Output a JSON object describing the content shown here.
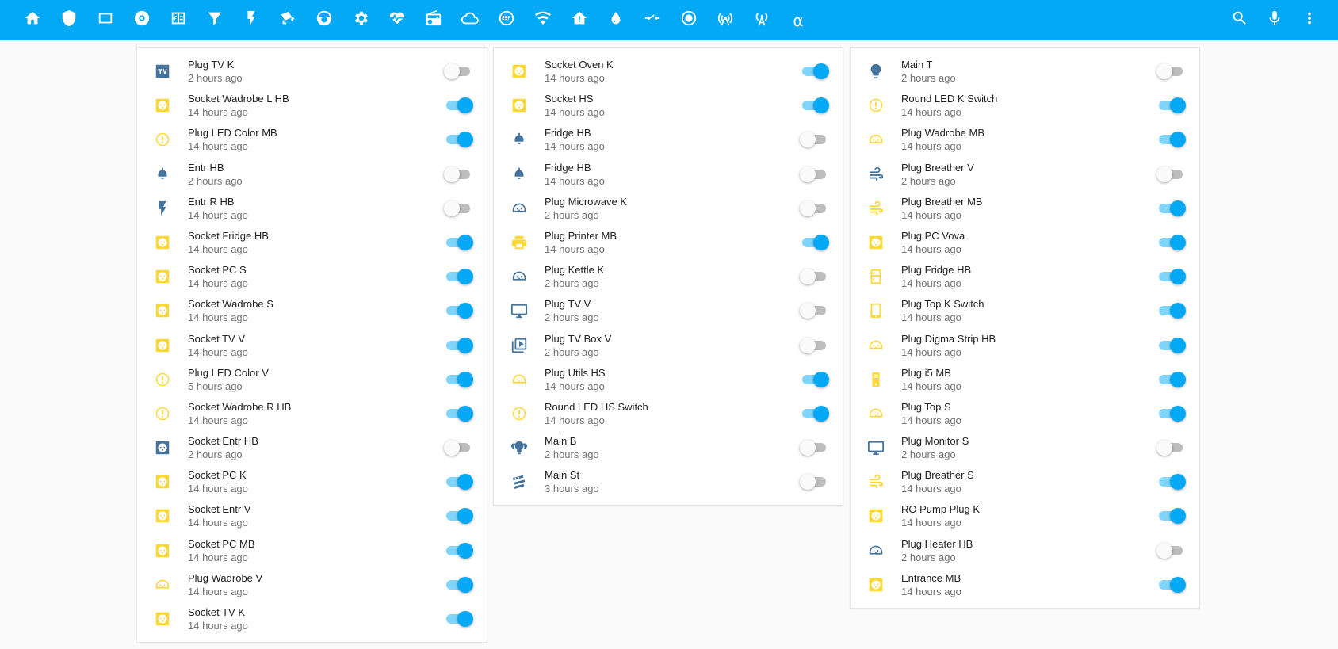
{
  "colors": {
    "header": "#03a9f4",
    "icon_on": "#fdd835",
    "icon_off": "#44739e",
    "toggle_on": "#03a9f4"
  },
  "header": {
    "tabs": [
      {
        "icon": "home-icon"
      },
      {
        "icon": "shield-icon"
      },
      {
        "icon": "square-icon"
      },
      {
        "icon": "disc-icon"
      },
      {
        "icon": "calculator-icon"
      },
      {
        "icon": "filter-icon"
      },
      {
        "icon": "flash-icon"
      },
      {
        "icon": "cctv-icon"
      },
      {
        "icon": "robot-vacuum-icon"
      },
      {
        "icon": "gear-icon"
      },
      {
        "icon": "heart-pulse-icon"
      },
      {
        "icon": "radio-icon"
      },
      {
        "icon": "cloud-icon"
      },
      {
        "icon": "esp-icon"
      },
      {
        "icon": "wifi-icon"
      },
      {
        "icon": "home-alert-icon"
      },
      {
        "icon": "water-icon"
      },
      {
        "icon": "switch-icon"
      },
      {
        "icon": "record-icon"
      },
      {
        "icon": "access-point-icon"
      },
      {
        "icon": "antenna-icon"
      },
      {
        "icon": "alpha-icon",
        "text": "α"
      }
    ],
    "actions": [
      {
        "icon": "search-icon"
      },
      {
        "icon": "microphone-icon"
      },
      {
        "icon": "more-vertical-icon"
      }
    ]
  },
  "cards": [
    {
      "rows": [
        {
          "name": "Plug TV K",
          "time": "2 hours ago",
          "on": false,
          "icon": "tv-box-icon"
        },
        {
          "name": "Socket Wadrobe L HB",
          "time": "14 hours ago",
          "on": true,
          "icon": "power-socket-icon"
        },
        {
          "name": "Plug LED Color MB",
          "time": "14 hours ago",
          "on": true,
          "icon": "led-icon"
        },
        {
          "name": "Entr HB",
          "time": "2 hours ago",
          "on": false,
          "icon": "ceiling-light-icon"
        },
        {
          "name": "Entr R HB",
          "time": "14 hours ago",
          "on": false,
          "icon": "flash-icon"
        },
        {
          "name": "Socket Fridge HB",
          "time": "14 hours ago",
          "on": true,
          "icon": "power-socket-icon"
        },
        {
          "name": "Socket PC S",
          "time": "14 hours ago",
          "on": true,
          "icon": "power-socket-icon"
        },
        {
          "name": "Socket Wadrobe S",
          "time": "14 hours ago",
          "on": true,
          "icon": "power-socket-icon"
        },
        {
          "name": "Socket TV V",
          "time": "14 hours ago",
          "on": true,
          "icon": "power-socket-icon"
        },
        {
          "name": "Plug LED Color V",
          "time": "5 hours ago",
          "on": true,
          "icon": "led-icon"
        },
        {
          "name": "Socket Wadrobe R HB",
          "time": "14 hours ago",
          "on": true,
          "icon": "led-icon"
        },
        {
          "name": "Socket Entr HB",
          "time": "2 hours ago",
          "on": false,
          "icon": "power-socket-icon"
        },
        {
          "name": "Socket PC K",
          "time": "14 hours ago",
          "on": true,
          "icon": "power-socket-icon"
        },
        {
          "name": "Socket Entr V",
          "time": "14 hours ago",
          "on": true,
          "icon": "power-socket-icon"
        },
        {
          "name": "Socket PC MB",
          "time": "14 hours ago",
          "on": true,
          "icon": "power-socket-icon"
        },
        {
          "name": "Plug Wadrobe V",
          "time": "14 hours ago",
          "on": true,
          "icon": "plug-icon"
        },
        {
          "name": "Socket TV K",
          "time": "14 hours ago",
          "on": true,
          "icon": "power-socket-icon"
        }
      ]
    },
    {
      "rows": [
        {
          "name": "Socket Oven K",
          "time": "14 hours ago",
          "on": true,
          "icon": "power-socket-icon"
        },
        {
          "name": "Socket HS",
          "time": "14 hours ago",
          "on": true,
          "icon": "power-socket-icon"
        },
        {
          "name": "Fridge HB",
          "time": "14 hours ago",
          "on": false,
          "icon": "ceiling-light-icon"
        },
        {
          "name": "Fridge HB",
          "time": "14 hours ago",
          "on": false,
          "icon": "ceiling-light-icon"
        },
        {
          "name": "Plug Microwave K",
          "time": "2 hours ago",
          "on": false,
          "icon": "plug-icon"
        },
        {
          "name": "Plug Printer MB",
          "time": "14 hours ago",
          "on": true,
          "icon": "printer-icon"
        },
        {
          "name": "Plug Kettle K",
          "time": "2 hours ago",
          "on": false,
          "icon": "plug-icon"
        },
        {
          "name": "Plug TV V",
          "time": "2 hours ago",
          "on": false,
          "icon": "monitor-icon"
        },
        {
          "name": "Plug TV Box V",
          "time": "2 hours ago",
          "on": false,
          "icon": "play-box-icon"
        },
        {
          "name": "Plug Utils HS",
          "time": "14 hours ago",
          "on": true,
          "icon": "plug-icon"
        },
        {
          "name": "Round LED HS Switch",
          "time": "14 hours ago",
          "on": true,
          "icon": "led-icon"
        },
        {
          "name": "Main B",
          "time": "2 hours ago",
          "on": false,
          "icon": "lightbulb-group-icon"
        },
        {
          "name": "Main St",
          "time": "3 hours ago",
          "on": false,
          "icon": "led-strip-icon"
        }
      ]
    },
    {
      "rows": [
        {
          "name": "Main T",
          "time": "2 hours ago",
          "on": false,
          "icon": "lightbulb-icon"
        },
        {
          "name": "Round LED K Switch",
          "time": "14 hours ago",
          "on": true,
          "icon": "led-icon"
        },
        {
          "name": "Plug Wadrobe MB",
          "time": "14 hours ago",
          "on": true,
          "icon": "plug-icon"
        },
        {
          "name": "Plug Breather V",
          "time": "2 hours ago",
          "on": false,
          "icon": "wind-icon"
        },
        {
          "name": "Plug Breather MB",
          "time": "14 hours ago",
          "on": true,
          "icon": "wind-icon"
        },
        {
          "name": "Plug PC Vova",
          "time": "14 hours ago",
          "on": true,
          "icon": "power-socket-icon"
        },
        {
          "name": "Plug Fridge HB",
          "time": "14 hours ago",
          "on": true,
          "icon": "fridge-icon"
        },
        {
          "name": "Plug Top K Switch",
          "time": "14 hours ago",
          "on": true,
          "icon": "tablet-icon"
        },
        {
          "name": "Plug Digma Strip HB",
          "time": "14 hours ago",
          "on": true,
          "icon": "plug-icon"
        },
        {
          "name": "Plug i5 MB",
          "time": "14 hours ago",
          "on": true,
          "icon": "desktop-tower-icon"
        },
        {
          "name": "Plug Top S",
          "time": "14 hours ago",
          "on": true,
          "icon": "plug-icon"
        },
        {
          "name": "Plug Monitor S",
          "time": "2 hours ago",
          "on": false,
          "icon": "monitor-icon"
        },
        {
          "name": "Plug Breather S",
          "time": "14 hours ago",
          "on": true,
          "icon": "wind-icon"
        },
        {
          "name": "RO Pump Plug K",
          "time": "14 hours ago",
          "on": true,
          "icon": "power-socket-icon"
        },
        {
          "name": "Plug Heater HB",
          "time": "2 hours ago",
          "on": false,
          "icon": "plug-icon"
        },
        {
          "name": "Entrance MB",
          "time": "14 hours ago",
          "on": true,
          "icon": "power-socket-icon"
        }
      ]
    }
  ]
}
